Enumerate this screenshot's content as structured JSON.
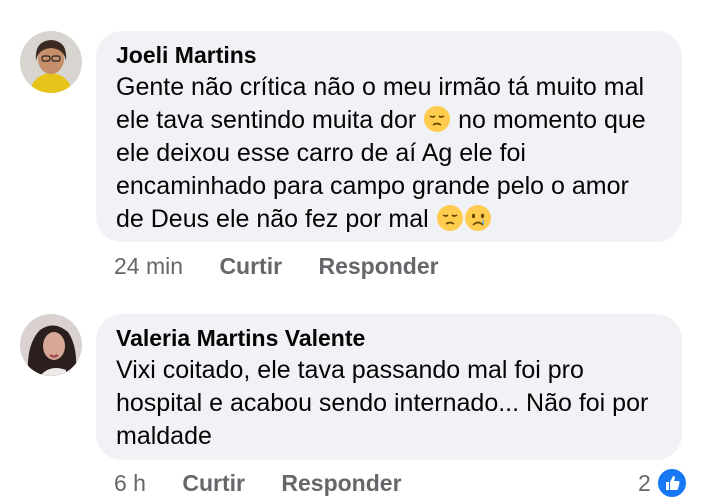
{
  "comments": [
    {
      "author": "Joeli Martins",
      "text_parts": [
        "Gente não crítica não o meu irmão tá muito mal ele tava sentindo muita dor ",
        " no momento que ele deixou esse carro de aí Ag ele foi encaminhado para campo grande pelo o amor de Deus ele não fez por mal "
      ],
      "emojis": [
        "pensive-face-icon",
        "pensive-face-icon",
        "crying-face-icon"
      ],
      "time": "24 min",
      "like_label": "Curtir",
      "reply_label": "Responder"
    },
    {
      "author": "Valeria Martins Valente",
      "text": "Vixi coitado, ele tava passando mal foi pro hospital e acabou sendo internado... Não foi por maldade",
      "time": "6 h",
      "like_label": "Curtir",
      "reply_label": "Responder",
      "reaction_count": "2",
      "reaction_icon": "thumbs-up-icon"
    }
  ],
  "colors": {
    "bubble": "#f0f2f5",
    "meta_text": "#65676b",
    "like_blue": "#1877f2"
  }
}
